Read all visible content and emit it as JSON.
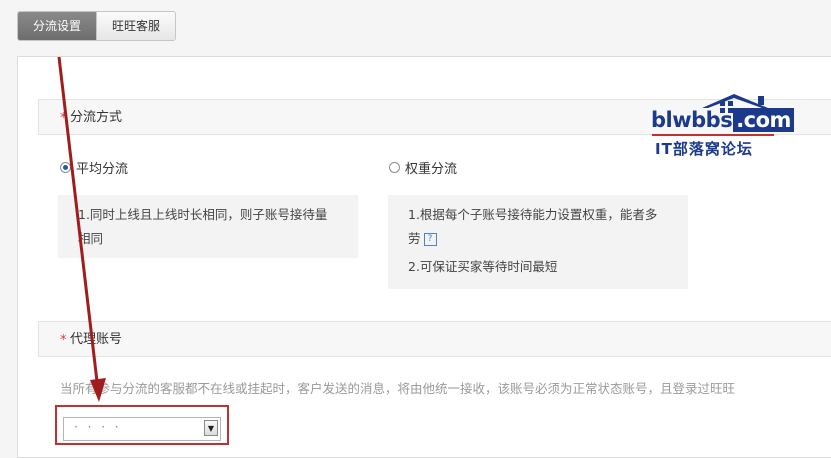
{
  "tabs": [
    {
      "label": "分流设置",
      "active": true
    },
    {
      "label": "旺旺客服",
      "active": false
    }
  ],
  "mode_section": {
    "required_mark": "*",
    "title": "分流方式"
  },
  "options": {
    "average": {
      "label": "平均分流",
      "selected": true,
      "desc_line1": "1.同时上线且上线时长相同，则子账号接待量",
      "desc_line2": "相同"
    },
    "weighted": {
      "label": "权重分流",
      "selected": false,
      "desc_line1": "1.根据每个子账号接待能力设置权重，能者多",
      "desc_line2": "劳",
      "help_glyph": "?",
      "desc_line3": "2.可保证买家等待时间最短"
    }
  },
  "agent_section": {
    "required_mark": "*",
    "title": "代理账号"
  },
  "agent_hint": "当所有参与分流的客服都不在线或挂起时，客户发送的消息，将由他统一接收，该账号必须为正常状态账号，且登录过旺旺",
  "agent_select": {
    "value": "· · · ·"
  },
  "watermark": {
    "site": "blwbbs",
    "domain": ".com",
    "subtitle": "IT部落窝论坛"
  },
  "colors": {
    "accent_red": "#c23030",
    "logo_blue": "#1c3a8c",
    "radio_blue": "#1a5ea8"
  }
}
